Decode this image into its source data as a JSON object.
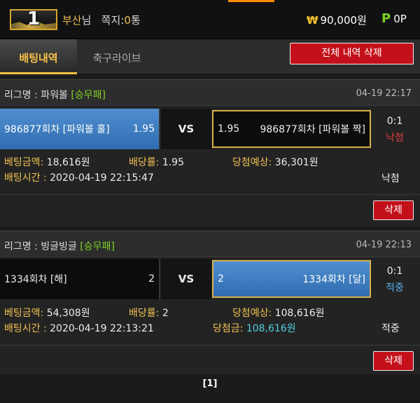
{
  "header": {
    "level": "1",
    "user_name": "부산",
    "user_suffix": "님",
    "message_label": "쪽지:",
    "message_count": "0",
    "message_unit": "통",
    "currency_symbol": "₩",
    "money": "90,000원",
    "point_label": "P",
    "point_value": "0P"
  },
  "tabs": [
    {
      "label": "배팅내역"
    },
    {
      "label": "축구라이브"
    }
  ],
  "delete_all_label": "전체 내역 삭제",
  "bets": [
    {
      "league_label": "리그명 : 파워볼",
      "league_tag": "[승무패]",
      "datetime": "04-19 22:17",
      "home_name": "986877회차 [파워볼 홀]",
      "home_odds": "1.95",
      "vs": "VS",
      "away_odds": "1.95",
      "away_name": "986877회차 [파워볼 짝]",
      "score": "0:1",
      "result": "낙첨",
      "amount_label": "베팅금액:",
      "amount": "18,616원",
      "rate_label": "배당률:",
      "rate": "1.95",
      "expect_label": "당첨예상:",
      "expect": "36,301원",
      "time_label": "배팅시간 :",
      "time": "2020-04-19 22:15:47",
      "final_label": "",
      "final_value": "",
      "status": "낙첨",
      "delete_label": "삭제"
    },
    {
      "league_label": "리그명 : 빙글빙글",
      "league_tag": "[승무패]",
      "datetime": "04-19 22:13",
      "home_name": "1334회차 [해]",
      "home_odds": "2",
      "vs": "VS",
      "away_odds": "2",
      "away_name": "1334회차 [달]",
      "score": "0:1",
      "result": "적중",
      "amount_label": "베팅금액:",
      "amount": "54,308원",
      "rate_label": "배당률:",
      "rate": "2",
      "expect_label": "당첨예상:",
      "expect": "108,616원",
      "time_label": "배팅시간 :",
      "time": "2020-04-19 22:13:21",
      "final_label": "당첨금:",
      "final_value": "108,616원",
      "status": "적중",
      "delete_label": "삭제"
    }
  ],
  "pagination": "[1]"
}
